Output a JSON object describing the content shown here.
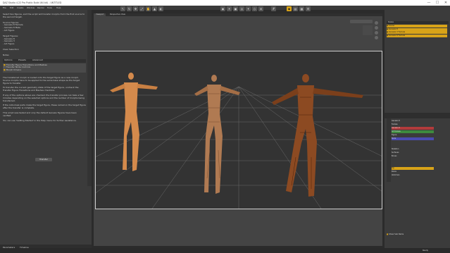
{
  "window": {
    "title": "DAZ Studio 4.22 Pro Public Build (64 bit) - UNTITLED",
    "controls": [
      "—",
      "☐",
      "✕"
    ]
  },
  "menu": [
    "File",
    "Edit",
    "Create",
    "Window",
    "Render",
    "Tools",
    "Help"
  ],
  "viewport": {
    "tabs": [
      "Viewport",
      "Perspective View"
    ]
  },
  "left_panel": {
    "intro": "Select two figures, and the script will transfer morphs from the first source to the second target.",
    "source_header": "Source Figures:",
    "source_items": [
      "- Genesis 8 Female",
      "- Genesis 8 Male",
      "- G3 Figure"
    ],
    "target_header": "Target Figures:",
    "target_items": [
      "- Genesis 8",
      "- Genesis 3",
      "- G3 Figure"
    ],
    "clear_label": "Clear Selection",
    "notes_header": "Notes",
    "tabs": [
      "Options",
      "Presets",
      "Advanced"
    ],
    "options": [
      {
        "label": "Transfer Figure Transitions and Meshes",
        "checked": true
      },
      {
        "label": "Transfer Node Controls",
        "checked": false
      },
      {
        "label": "Morph Drivers",
        "checked": true
      }
    ],
    "help_paragraphs": [
      "The transferred morph is loaded onto the target figure as a new morph. Source morphs have to be applied to the same base shape as the target figure to transfer.",
      "To transfer the current geometry state of the target figure, uncheck the Transfer Figure Transitions and Meshes checkbox.",
      "If any of the options above are checked, the transfer process can take a few minutes depending on the selected options and the number of morphs being transferred.",
      "If the individual parts make the target figure, these remain in the target figure after the transfer is complete.",
      "This script was tested and only the default Genesis figures have been verified.",
      "You can use 'Getting Started' in the Help menu for further assistance."
    ],
    "accept_label": "Transfer",
    "bottom_tabs": [
      "Parameters",
      "Timeline"
    ]
  },
  "right_panel": {
    "header": "Scene",
    "scene_items": [
      "Scene",
      "Genesis 8",
      "Genesis 3 Female",
      "Genesis 8 Female"
    ],
    "tree_items": [
      "Genesis 8",
      "Female",
      "Genesis 8",
      "G3 Female",
      "Figure",
      "Node",
      "Skeleton",
      "Surfaces",
      "Bones",
      "Hip",
      "Pelvis",
      "Abdomen"
    ],
    "footer_label": "Show Sub Items"
  },
  "status": {
    "left": "",
    "right": "Ready"
  },
  "colors": {
    "accent": "#d8a318",
    "stage_border": "#cfcfcf",
    "panel": "#3b3b3b"
  },
  "figures": [
    {
      "name": "figure-left",
      "texture": "solid"
    },
    {
      "name": "figure-middle",
      "texture": "wireframe"
    },
    {
      "name": "figure-right",
      "texture": "wireframe-dark"
    }
  ]
}
